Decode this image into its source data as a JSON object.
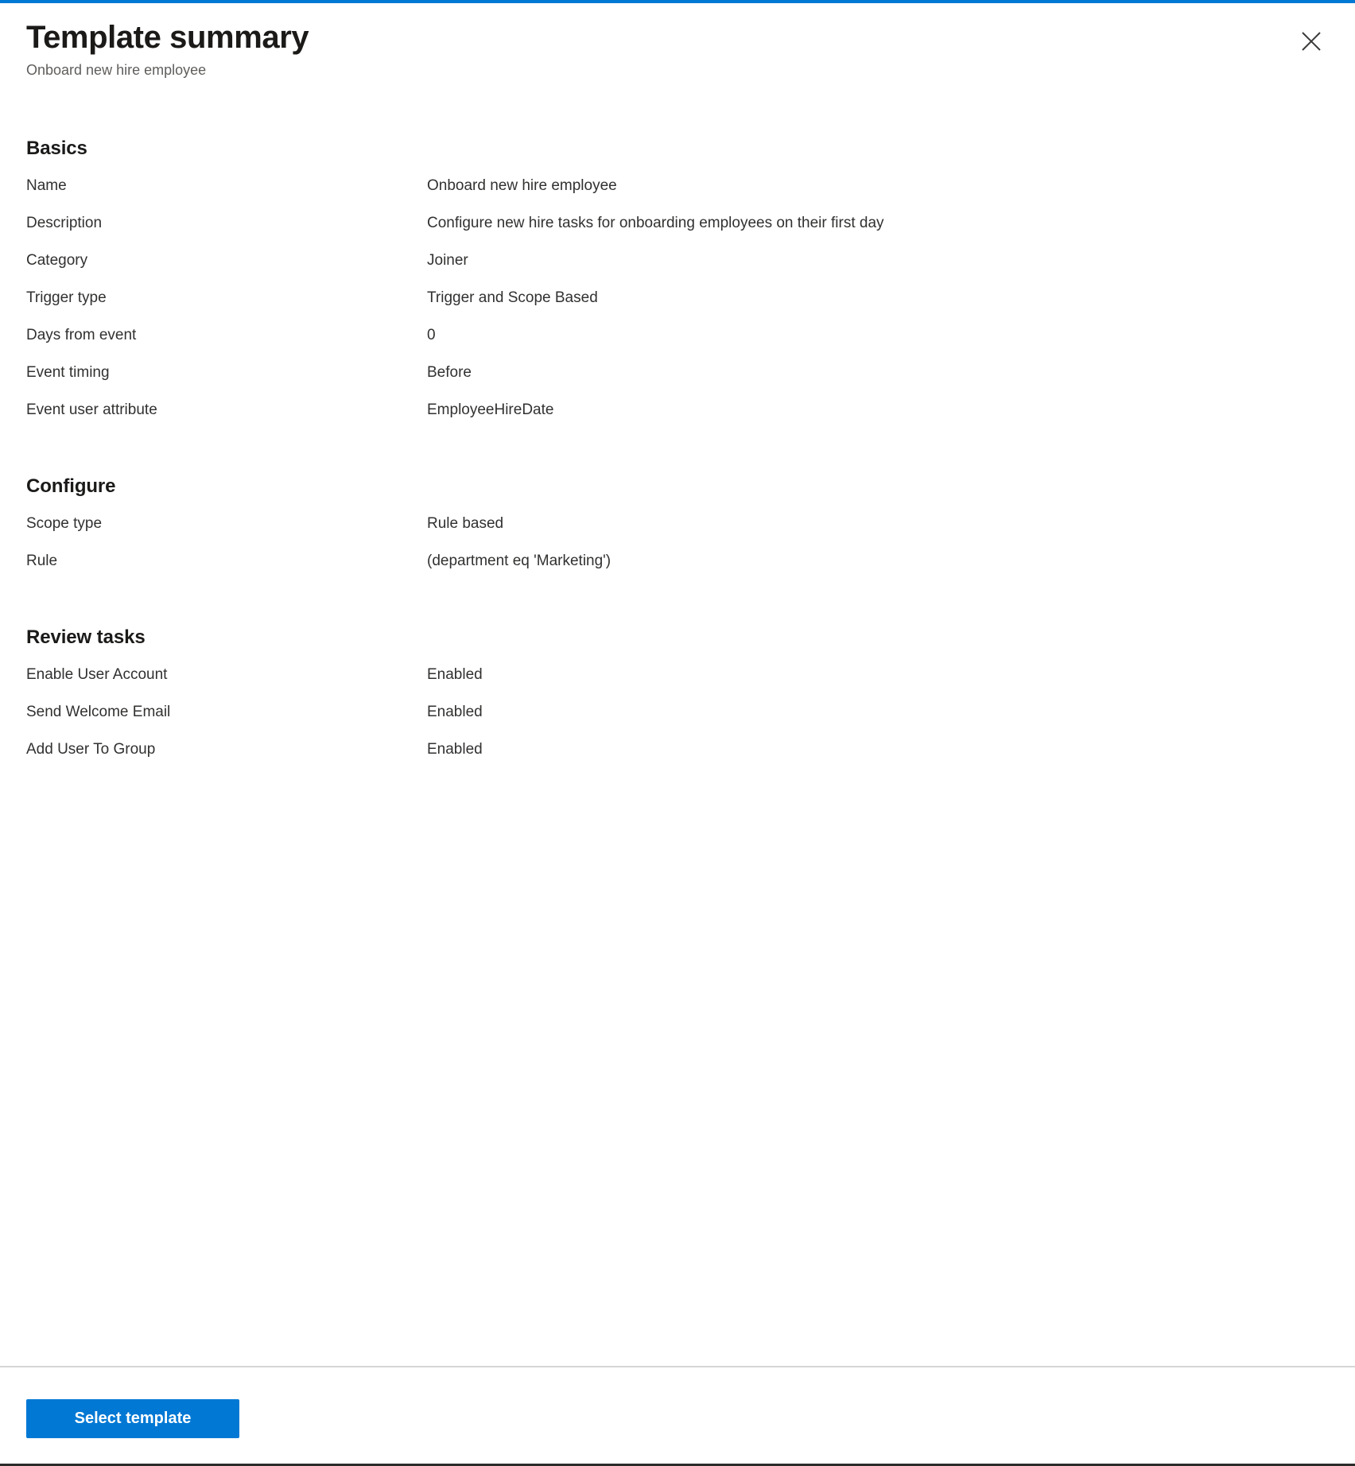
{
  "accent_color": "#0078d4",
  "header": {
    "title": "Template summary",
    "subtitle": "Onboard new hire employee",
    "close_icon": "close-icon",
    "close_label": "Close"
  },
  "sections": [
    {
      "heading": "Basics",
      "rows": [
        {
          "label": "Name",
          "value": "Onboard new hire employee"
        },
        {
          "label": "Description",
          "value": "Configure new hire tasks for onboarding employees on their first day"
        },
        {
          "label": "Category",
          "value": "Joiner"
        },
        {
          "label": "Trigger type",
          "value": "Trigger and Scope Based"
        },
        {
          "label": "Days from event",
          "value": "0"
        },
        {
          "label": "Event timing",
          "value": "Before"
        },
        {
          "label": "Event user attribute",
          "value": "EmployeeHireDate"
        }
      ]
    },
    {
      "heading": "Configure",
      "rows": [
        {
          "label": "Scope type",
          "value": "Rule based"
        },
        {
          "label": "Rule",
          "value": "(department eq 'Marketing')"
        }
      ]
    },
    {
      "heading": "Review tasks",
      "rows": [
        {
          "label": "Enable User Account",
          "value": "Enabled"
        },
        {
          "label": "Send Welcome Email",
          "value": "Enabled"
        },
        {
          "label": "Add User To Group",
          "value": "Enabled"
        }
      ]
    }
  ],
  "footer": {
    "primary_button_label": "Select template"
  }
}
